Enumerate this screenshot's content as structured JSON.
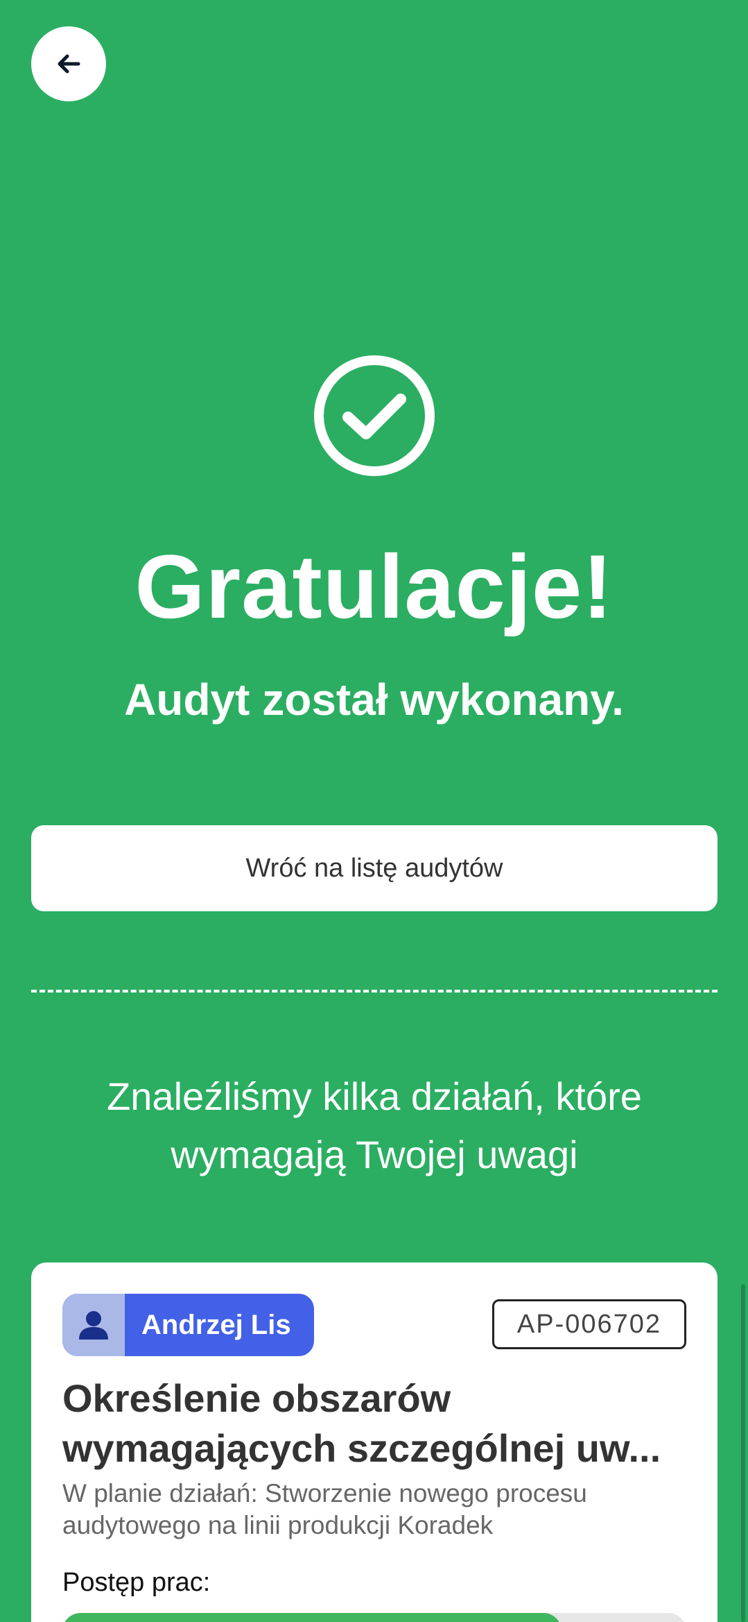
{
  "header": {
    "back_icon": "arrow-left-icon"
  },
  "success": {
    "icon": "check-circle-icon",
    "title": "Gratulacje!",
    "subtitle": "Audyt został wykonany."
  },
  "actions": {
    "return_label": "Wróć na listę audytów"
  },
  "notice": {
    "line1": "Znaleźliśmy kilka działań, które",
    "line2": "wymagają Twojej uwagi"
  },
  "task_card": {
    "assignee": {
      "icon": "user-icon",
      "name": "Andrzej Lis"
    },
    "reference": "AP-006702",
    "title_line1": "Określenie obszarów",
    "title_line2": "wymagających szczególnej uw...",
    "plan_line1": "W planie działań: Stworzenie nowego procesu",
    "plan_line2": "audytowego na linii produkcji Koradek",
    "progress_label": "Postęp prac:",
    "progress_fraction": 0.8
  },
  "colors": {
    "background": "#2bae62",
    "assignee_chip": "#4361e6",
    "progress_fill": "#3fb75e"
  }
}
